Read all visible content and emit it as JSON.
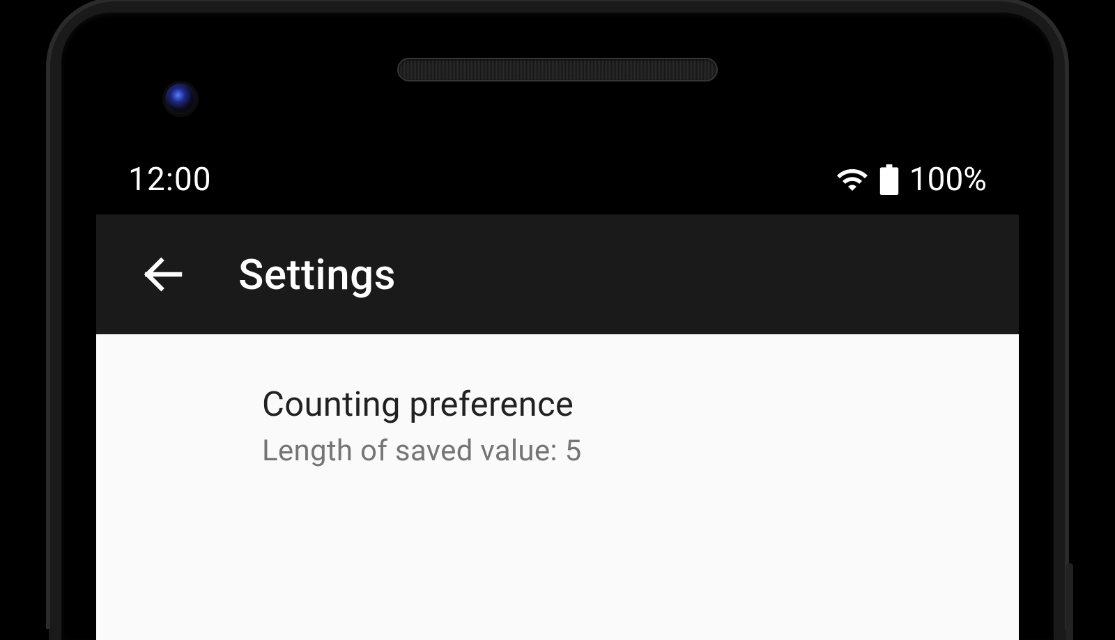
{
  "status_bar": {
    "time": "12:00",
    "battery_percent": "100%"
  },
  "app_bar": {
    "title": "Settings"
  },
  "preferences": {
    "counting": {
      "title": "Counting preference",
      "summary": "Length of saved value: 5"
    }
  }
}
